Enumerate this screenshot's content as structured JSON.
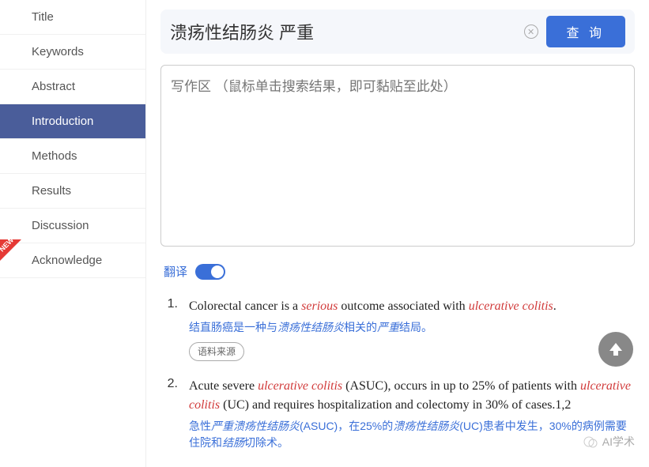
{
  "sidebar": {
    "items": [
      {
        "label": "Title"
      },
      {
        "label": "Keywords"
      },
      {
        "label": "Abstract"
      },
      {
        "label": "Introduction"
      },
      {
        "label": "Methods"
      },
      {
        "label": "Results"
      },
      {
        "label": "Discussion"
      },
      {
        "label": "Acknowledge"
      }
    ]
  },
  "search": {
    "value": "溃疡性结肠炎 严重",
    "button": "查 询"
  },
  "writing": {
    "placeholder": "写作区 （鼠标单击搜索结果，即可黏贴至此处）"
  },
  "translate": {
    "label": "翻译"
  },
  "results": [
    {
      "num": "1.",
      "text_parts": [
        "Colorectal cancer is a ",
        "serious",
        " outcome associated with ",
        "ulcerative colitis",
        "."
      ],
      "translation_parts": [
        "结直肠癌是一种与",
        "溃疡性结肠炎",
        "相关的",
        "严重",
        "结局。"
      ],
      "source_label": "语料来源"
    },
    {
      "num": "2.",
      "text_parts": [
        "Acute severe ",
        "ulcerative colitis",
        " (ASUC), occurs in up to 25% of patients with ",
        "ulcerative colitis",
        " (UC) and requires hospitalization and colectomy in 30% of cases.1,2"
      ],
      "translation_parts": [
        "急性",
        "严重溃疡性结肠炎",
        "(ASUC)，在25%的",
        "溃疡性结肠炎",
        "(UC)患者中发生，30%的病例需要住院和",
        "结肠",
        "切除术。"
      ]
    }
  ],
  "footer": {
    "tag": "AI学术"
  }
}
